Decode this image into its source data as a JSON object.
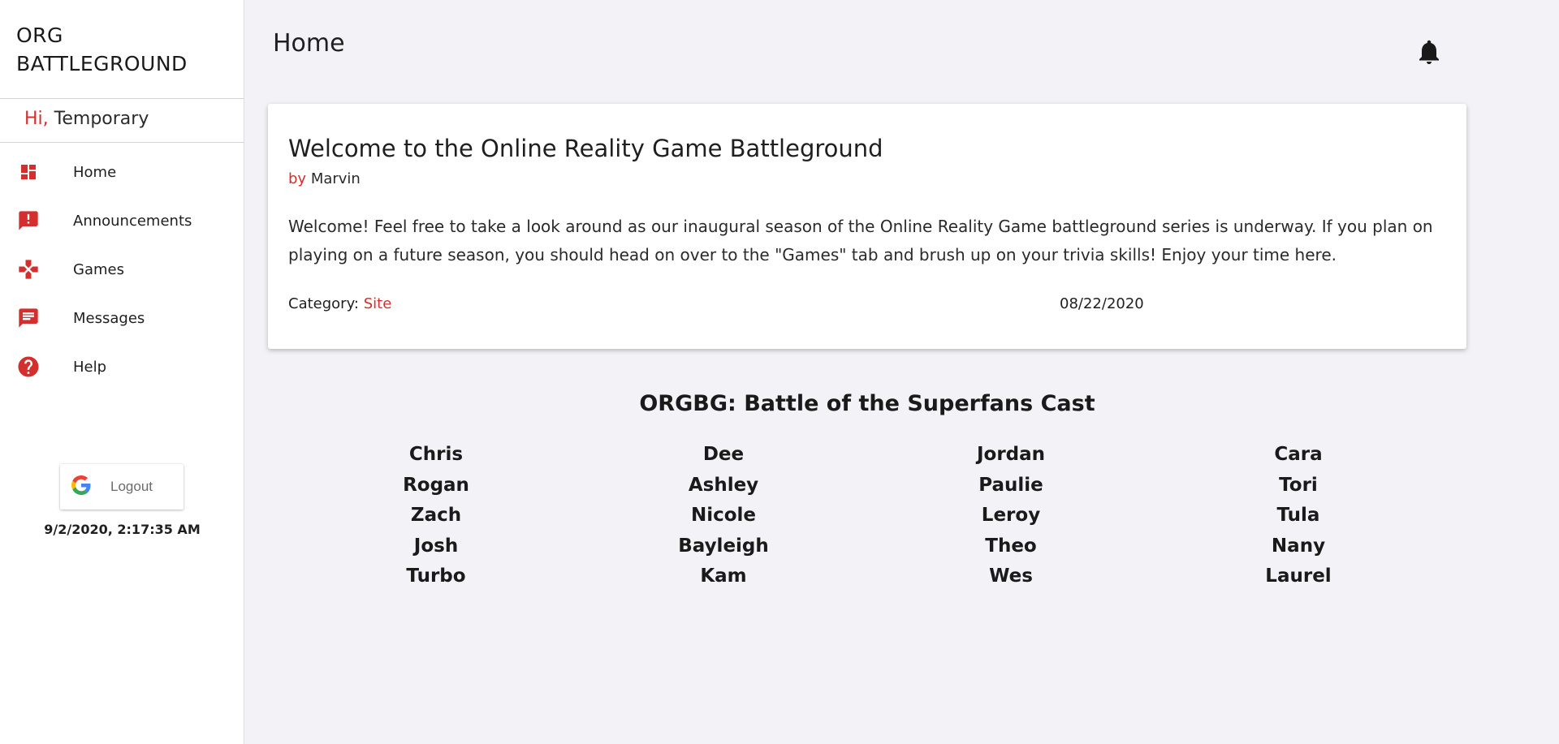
{
  "sidebar": {
    "brand_line1": "ORG",
    "brand_line2": "BATTLEGROUND",
    "greeting_prefix": "Hi,",
    "greeting_name": "Temporary",
    "nav_items": [
      {
        "label": "Home",
        "icon": "dashboard-icon"
      },
      {
        "label": "Announcements",
        "icon": "announcement-icon"
      },
      {
        "label": "Games",
        "icon": "gamepad-icon"
      },
      {
        "label": "Messages",
        "icon": "message-icon"
      },
      {
        "label": "Help",
        "icon": "help-icon"
      }
    ],
    "logout_label": "Logout",
    "timestamp": "9/2/2020, 2:17:35 AM"
  },
  "header": {
    "title": "Home"
  },
  "announcement": {
    "title": "Welcome to the Online Reality Game Battleground",
    "by_prefix": "by",
    "author": "Marvin",
    "body": "Welcome! Feel free to take a look around as our inaugural season of the Online Reality Game battleground series is underway. If you plan on playing on a future season, you should head on over to the \"Games\" tab and brush up on your trivia skills! Enjoy your time here.",
    "category_label": "Category:",
    "category": "Site",
    "date": "08/22/2020"
  },
  "cast": {
    "title": "ORGBG: Battle of the Superfans Cast",
    "columns": [
      [
        "Chris",
        "Rogan",
        "Zach",
        "Josh",
        "Turbo"
      ],
      [
        "Dee",
        "Ashley",
        "Nicole",
        "Bayleigh",
        "Kam"
      ],
      [
        "Jordan",
        "Paulie",
        "Leroy",
        "Theo",
        "Wes"
      ],
      [
        "Cara",
        "Tori",
        "Tula",
        "Nany",
        "Laurel"
      ]
    ]
  },
  "colors": {
    "accent": "#d32f2f",
    "background": "#f3f2f7"
  }
}
